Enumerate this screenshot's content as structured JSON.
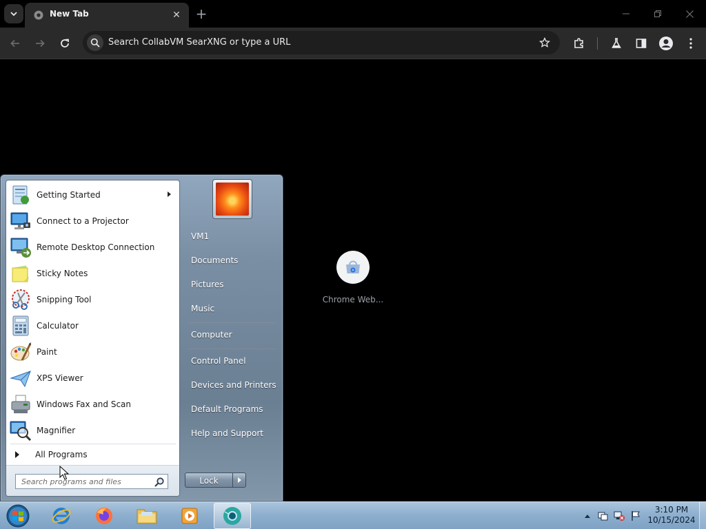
{
  "browser": {
    "tab": {
      "title": "New Tab",
      "close_glyph": "✕"
    },
    "new_tab_glyph": "+",
    "omnibox": {
      "placeholder": "Search CollabVM SearXNG or type a URL"
    },
    "shortcut": {
      "label": "Chrome Web..."
    }
  },
  "start_menu": {
    "programs": [
      {
        "label": "Getting Started",
        "icon": "getting-started-icon",
        "has_submenu": true
      },
      {
        "label": "Connect to a Projector",
        "icon": "projector-icon",
        "has_submenu": false
      },
      {
        "label": "Remote Desktop Connection",
        "icon": "remote-desktop-icon",
        "has_submenu": false
      },
      {
        "label": "Sticky Notes",
        "icon": "sticky-notes-icon",
        "has_submenu": false
      },
      {
        "label": "Snipping Tool",
        "icon": "snipping-tool-icon",
        "has_submenu": false
      },
      {
        "label": "Calculator",
        "icon": "calculator-icon",
        "has_submenu": false
      },
      {
        "label": "Paint",
        "icon": "paint-icon",
        "has_submenu": false
      },
      {
        "label": "XPS Viewer",
        "icon": "xps-viewer-icon",
        "has_submenu": false
      },
      {
        "label": "Windows Fax and Scan",
        "icon": "fax-scan-icon",
        "has_submenu": false
      },
      {
        "label": "Magnifier",
        "icon": "magnifier-icon",
        "has_submenu": false
      }
    ],
    "all_programs": "All Programs",
    "search_placeholder": "Search programs and files",
    "right_items": [
      "VM1",
      "Documents",
      "Pictures",
      "Music",
      "Computer",
      "Control Panel",
      "Devices and Printers",
      "Default Programs",
      "Help and Support"
    ],
    "lock_label": "Lock"
  },
  "taskbar": {
    "apps": [
      "internet-explorer-icon",
      "firefox-icon",
      "file-explorer-icon",
      "media-player-icon",
      "chrome-app-icon"
    ],
    "clock": {
      "time": "3:10 PM",
      "date": "10/15/2024"
    }
  }
}
